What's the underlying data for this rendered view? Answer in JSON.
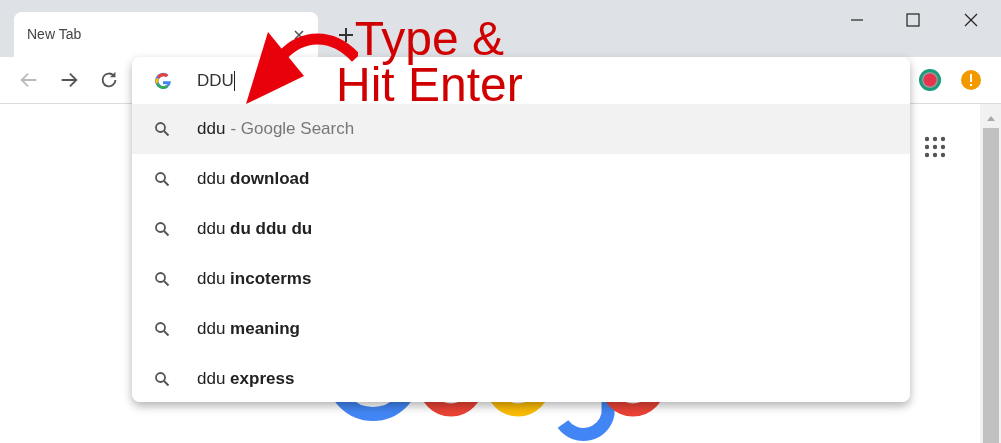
{
  "tabs": [
    {
      "title": "New Tab",
      "selected": true
    }
  ],
  "omnibox": {
    "value": "DDU"
  },
  "suggestions": [
    {
      "text": "ddu",
      "detail": "- Google Search",
      "selected": true
    },
    {
      "text": "ddu **download**",
      "selected": false
    },
    {
      "text": "ddu **du ddu du**",
      "selected": false
    },
    {
      "text": "ddu **incoterms**",
      "selected": false
    },
    {
      "text": "ddu **meaning**",
      "selected": false
    },
    {
      "text": "ddu **express**",
      "selected": false
    }
  ],
  "annotation": {
    "lines": [
      "Type &",
      "Hit Enter"
    ]
  }
}
